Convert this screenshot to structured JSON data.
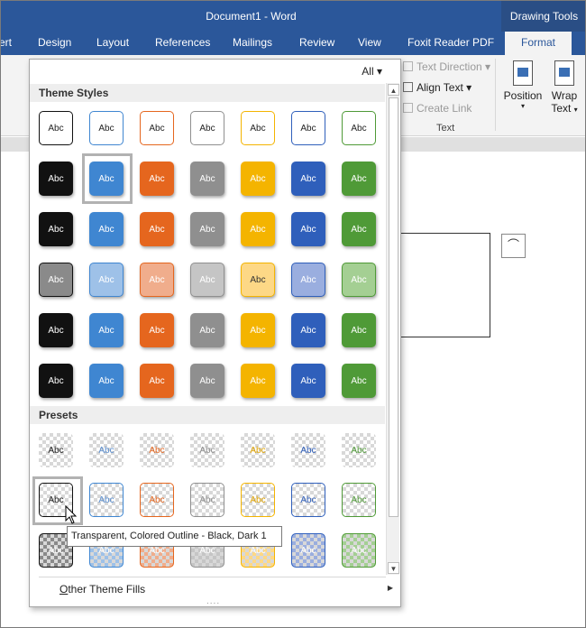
{
  "titlebar": {
    "title": "Document1 - Word",
    "context_header": "Drawing Tools"
  },
  "tabs": [
    {
      "label": "ert"
    },
    {
      "label": "Design"
    },
    {
      "label": "Layout"
    },
    {
      "label": "References"
    },
    {
      "label": "Mailings"
    },
    {
      "label": "Review"
    },
    {
      "label": "View"
    },
    {
      "label": "Foxit Reader PDF"
    },
    {
      "label": "Format"
    }
  ],
  "ribbon": {
    "text_direction": "Text Direction",
    "align_text": "Align Text",
    "create_link": "Create Link",
    "text_group": "Text",
    "position": "Position",
    "wrap_text_line1": "Wrap",
    "wrap_text_line2": "Text"
  },
  "gallery": {
    "filter": "All",
    "theme_styles_header": "Theme Styles",
    "presets_header": "Presets",
    "swatch_text": "Abc",
    "other_theme_fills_prefix": "O",
    "other_theme_fills_rest": "ther Theme Fills",
    "grip": "....",
    "tooltip": "Transparent, Colored Outline - Black, Dark 1"
  },
  "colors": {
    "accent": "#2b579a",
    "palette": [
      "#111111",
      "#3f86d1",
      "#e5661e",
      "#8f8f8f",
      "#f4b400",
      "#2f5fbb",
      "#4f9a37"
    ],
    "light_palette": [
      "#8a8a8a",
      "#9ec1e8",
      "#f0ad8c",
      "#c5c5c5",
      "#fdd886",
      "#9aaedf",
      "#a4cf93"
    ],
    "preset_text": [
      "#222222",
      "#5b8fd0",
      "#e5661e",
      "#8f8f8f",
      "#e3a500",
      "#2f5fbb",
      "#4f9a37"
    ]
  }
}
